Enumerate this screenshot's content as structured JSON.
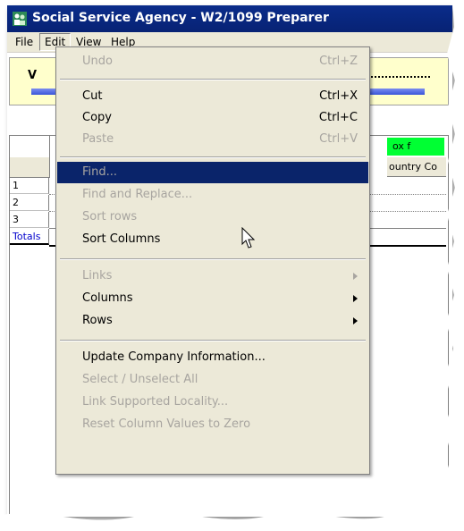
{
  "window": {
    "title": "Social Service Agency - W2/1099 Preparer",
    "colors": {
      "titlebar": "#0a2c8a",
      "menu_bg": "#ece9d8",
      "highlight": "#0a246a",
      "green_tab": "#00ff33",
      "banner": "#ffffcc"
    }
  },
  "menubar": {
    "file": "File",
    "edit": "Edit",
    "view": "View",
    "help": "Help"
  },
  "background": {
    "banner_letter": "V",
    "green_tab_label": "ox f",
    "column_header": "ountry Co",
    "rows": [
      "1",
      "2",
      "3"
    ],
    "totals_label": "Totals"
  },
  "edit_menu": {
    "undo": {
      "label": "Undo",
      "shortcut": "Ctrl+Z"
    },
    "cut": {
      "label": "Cut",
      "shortcut": "Ctrl+X"
    },
    "copy": {
      "label": "Copy",
      "shortcut": "Ctrl+C"
    },
    "paste": {
      "label": "Paste",
      "shortcut": "Ctrl+V"
    },
    "find": {
      "label": "Find..."
    },
    "find_replace": {
      "label": "Find and Replace..."
    },
    "sort_rows": {
      "label": "Sort rows"
    },
    "sort_columns": {
      "label": "Sort Columns"
    },
    "links": {
      "label": "Links"
    },
    "columns": {
      "label": "Columns"
    },
    "rows": {
      "label": "Rows"
    },
    "update_company": {
      "label": "Update Company Information..."
    },
    "select_unselect": {
      "label": "Select / Unselect All"
    },
    "link_locality": {
      "label": "Link Supported Locality..."
    },
    "reset_columns": {
      "label": "Reset Column Values to Zero"
    }
  },
  "icons": {
    "app": "people-icon",
    "cursor": "mouse-pointer-icon",
    "submenu": "chevron-right-icon"
  }
}
